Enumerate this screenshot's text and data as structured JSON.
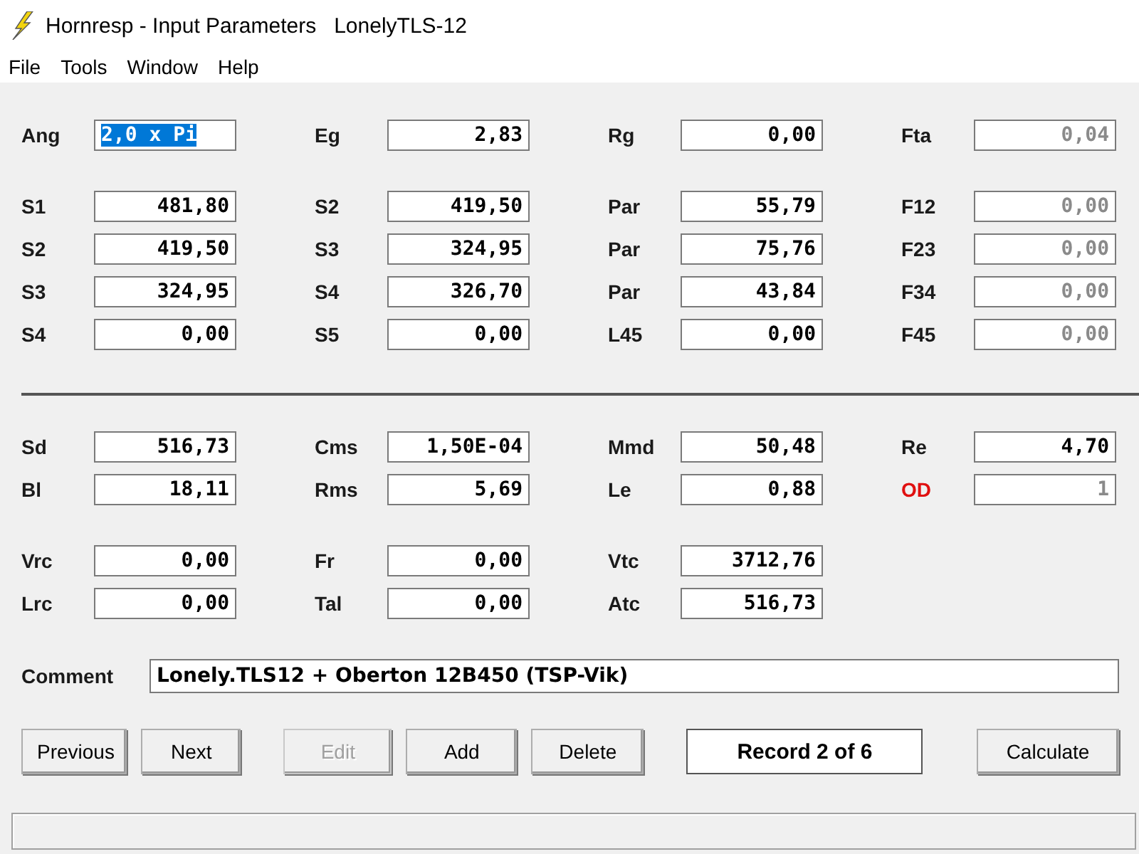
{
  "window": {
    "title": "Hornresp - Input Parameters   LonelyTLS-12"
  },
  "menu": [
    "File",
    "Tools",
    "Window",
    "Help"
  ],
  "groups": [
    {
      "kind": "fields",
      "rows": [
        [
          {
            "kind": "field",
            "label": "Ang",
            "value": "2,0 x Pi",
            "selected": true,
            "disabled": false,
            "alert": false
          },
          {
            "kind": "field",
            "label": "Eg",
            "value": "2,83",
            "selected": false,
            "disabled": false,
            "alert": false
          },
          {
            "kind": "field",
            "label": "Rg",
            "value": "0,00",
            "selected": false,
            "disabled": false,
            "alert": false
          },
          {
            "kind": "field",
            "label": "Fta",
            "value": "0,04",
            "selected": false,
            "disabled": true,
            "alert": false
          }
        ]
      ]
    },
    {
      "kind": "fields",
      "rows": [
        [
          {
            "kind": "field",
            "label": "S1",
            "value": "481,80",
            "selected": false,
            "disabled": false,
            "alert": false
          },
          {
            "kind": "field",
            "label": "S2",
            "value": "419,50",
            "selected": false,
            "disabled": false,
            "alert": false
          },
          {
            "kind": "field",
            "label": "Par",
            "value": "55,79",
            "selected": false,
            "disabled": false,
            "alert": false
          },
          {
            "kind": "field",
            "label": "F12",
            "value": "0,00",
            "selected": false,
            "disabled": true,
            "alert": false
          }
        ],
        [
          {
            "kind": "field",
            "label": "S2",
            "value": "419,50",
            "selected": false,
            "disabled": false,
            "alert": false
          },
          {
            "kind": "field",
            "label": "S3",
            "value": "324,95",
            "selected": false,
            "disabled": false,
            "alert": false
          },
          {
            "kind": "field",
            "label": "Par",
            "value": "75,76",
            "selected": false,
            "disabled": false,
            "alert": false
          },
          {
            "kind": "field",
            "label": "F23",
            "value": "0,00",
            "selected": false,
            "disabled": true,
            "alert": false
          }
        ],
        [
          {
            "kind": "field",
            "label": "S3",
            "value": "324,95",
            "selected": false,
            "disabled": false,
            "alert": false
          },
          {
            "kind": "field",
            "label": "S4",
            "value": "326,70",
            "selected": false,
            "disabled": false,
            "alert": false
          },
          {
            "kind": "field",
            "label": "Par",
            "value": "43,84",
            "selected": false,
            "disabled": false,
            "alert": false
          },
          {
            "kind": "field",
            "label": "F34",
            "value": "0,00",
            "selected": false,
            "disabled": true,
            "alert": false
          }
        ],
        [
          {
            "kind": "field",
            "label": "S4",
            "value": "0,00",
            "selected": false,
            "disabled": false,
            "alert": false
          },
          {
            "kind": "field",
            "label": "S5",
            "value": "0,00",
            "selected": false,
            "disabled": false,
            "alert": false
          },
          {
            "kind": "field",
            "label": "L45",
            "value": "0,00",
            "selected": false,
            "disabled": false,
            "alert": false
          },
          {
            "kind": "field",
            "label": "F45",
            "value": "0,00",
            "selected": false,
            "disabled": true,
            "alert": false
          }
        ]
      ]
    },
    {
      "kind": "divider"
    },
    {
      "kind": "fields",
      "rows": [
        [
          {
            "kind": "field",
            "label": "Sd",
            "value": "516,73",
            "selected": false,
            "disabled": false,
            "alert": false
          },
          {
            "kind": "field",
            "label": "Cms",
            "value": "1,50E-04",
            "selected": false,
            "disabled": false,
            "alert": false
          },
          {
            "kind": "field",
            "label": "Mmd",
            "value": "50,48",
            "selected": false,
            "disabled": false,
            "alert": false
          },
          {
            "kind": "field",
            "label": "Re",
            "value": "4,70",
            "selected": false,
            "disabled": false,
            "alert": false
          }
        ],
        [
          {
            "kind": "field",
            "label": "Bl",
            "value": "18,11",
            "selected": false,
            "disabled": false,
            "alert": false
          },
          {
            "kind": "field",
            "label": "Rms",
            "value": "5,69",
            "selected": false,
            "disabled": false,
            "alert": false
          },
          {
            "kind": "field",
            "label": "Le",
            "value": "0,88",
            "selected": false,
            "disabled": false,
            "alert": false
          },
          {
            "kind": "field",
            "label": "OD",
            "value": "1",
            "selected": false,
            "disabled": true,
            "alert": true
          }
        ]
      ]
    },
    {
      "kind": "fields",
      "rows": [
        [
          {
            "kind": "field",
            "label": "Vrc",
            "value": "0,00",
            "selected": false,
            "disabled": false,
            "alert": false
          },
          {
            "kind": "field",
            "label": "Fr",
            "value": "0,00",
            "selected": false,
            "disabled": false,
            "alert": false
          },
          {
            "kind": "field",
            "label": "Vtc",
            "value": "3712,76",
            "selected": false,
            "disabled": false,
            "alert": false
          },
          {
            "kind": "empty"
          }
        ],
        [
          {
            "kind": "field",
            "label": "Lrc",
            "value": "0,00",
            "selected": false,
            "disabled": false,
            "alert": false
          },
          {
            "kind": "field",
            "label": "Tal",
            "value": "0,00",
            "selected": false,
            "disabled": false,
            "alert": false
          },
          {
            "kind": "field",
            "label": "Atc",
            "value": "516,73",
            "selected": false,
            "disabled": false,
            "alert": false
          },
          {
            "kind": "empty"
          }
        ]
      ]
    }
  ],
  "comment": {
    "label": "Comment",
    "value": "Lonely.TLS12 + Oberton 12B450 (TSP-Vik)"
  },
  "buttons": [
    {
      "kind": "button",
      "label": "Previous",
      "disabled": false
    },
    {
      "kind": "button",
      "label": "Next",
      "disabled": false
    },
    {
      "kind": "button",
      "label": "Edit",
      "disabled": true
    },
    {
      "kind": "button",
      "label": "Add",
      "disabled": false
    },
    {
      "kind": "button",
      "label": "Delete",
      "disabled": false
    },
    {
      "kind": "record",
      "label": "Record 2 of 6"
    },
    {
      "kind": "button",
      "label": "Calculate",
      "disabled": false
    }
  ]
}
